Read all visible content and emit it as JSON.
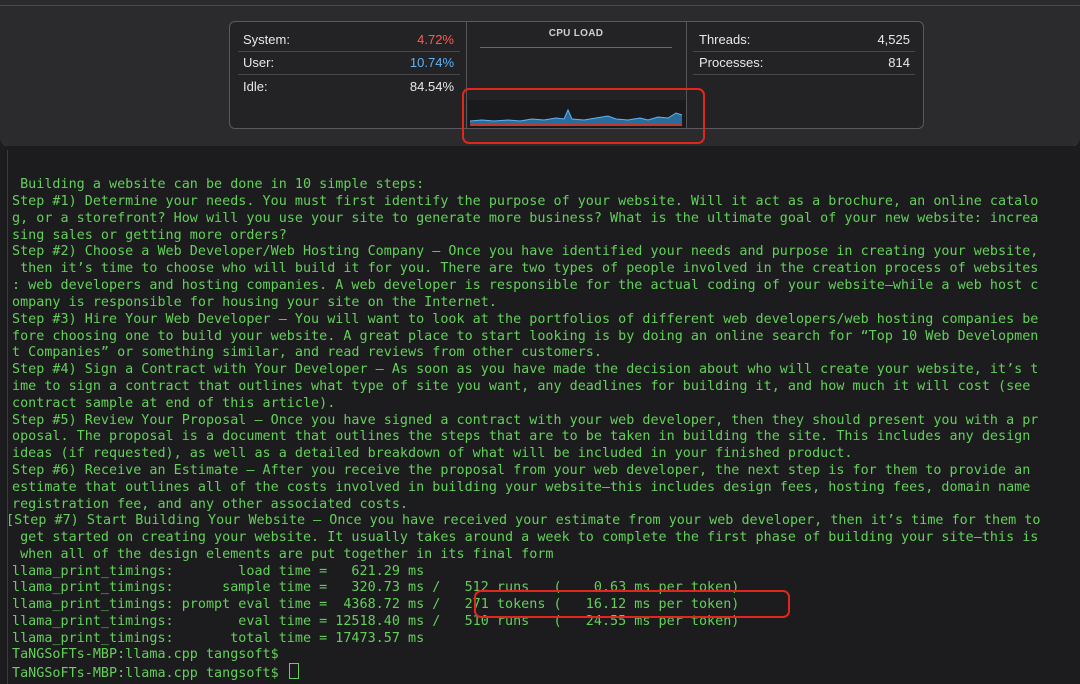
{
  "activity_monitor": {
    "system_label": "System:",
    "system_value": "4.72%",
    "user_label": "User:",
    "user_value": "10.74%",
    "idle_label": "Idle:",
    "idle_value": "84.54%",
    "cpu_title": "CPU LOAD",
    "threads_label": "Threads:",
    "threads_value": "4,525",
    "processes_label": "Processes:",
    "processes_value": "814",
    "colors": {
      "system": "#ff5b51",
      "user": "#5fb2f7",
      "highlight": "#e3261c"
    }
  },
  "terminal": {
    "lines": [
      " Building a website can be done in 10 simple steps:",
      "Step #1) Determine your needs. You must first identify the purpose of your website. Will it act as a brochure, an online catalo",
      "g, or a storefront? How will you use your site to generate more business? What is the ultimate goal of your new website: increa",
      "sing sales or getting more orders?",
      "Step #2) Choose a Web Developer/Web Hosting Company – Once you have identified your needs and purpose in creating your website,",
      " then it’s time to choose who will build it for you. There are two types of people involved in the creation process of websites",
      ": web developers and hosting companies. A web developer is responsible for the actual coding of your website—while a web host c",
      "ompany is responsible for housing your site on the Internet.",
      "Step #3) Hire Your Web Developer – You will want to look at the portfolios of different web developers/web hosting companies be",
      "fore choosing one to build your website. A great place to start looking is by doing an online search for “Top 10 Web Developmen",
      "t Companies” or something similar, and read reviews from other customers.",
      "Step #4) Sign a Contract with Your Developer – As soon as you have made the decision about who will create your website, it’s t",
      "ime to sign a contract that outlines what type of site you want, any deadlines for building it, and how much it will cost (see",
      "contract sample at end of this article).",
      "Step #5) Review Your Proposal – Once you have signed a contract with your web developer, then they should present you with a pr",
      "oposal. The proposal is a document that outlines the steps that are to be taken in building the site. This includes any design",
      "ideas (if requested), as well as a detailed breakdown of what will be included in your finished product.",
      "Step #6) Receive an Estimate – After you receive the proposal from your web developer, the next step is for them to provide an",
      "estimate that outlines all of the costs involved in building your website—this includes design fees, hosting fees, domain name",
      "registration fee, and any other associated costs.",
      "[Step #7) Start Building Your Website – Once you have received your estimate from your web developer, then it’s time for them to",
      " get started on creating your website. It usually takes around a week to complete the first phase of building your site—this is",
      " when all of the design elements are put together in its final form",
      "llama_print_timings:        load time =   621.29 ms",
      "llama_print_timings:      sample time =   320.73 ms /   512 runs   (    0.63 ms per token)",
      "llama_print_timings: prompt eval time =  4368.72 ms /   271 tokens (   16.12 ms per token)",
      "llama_print_timings:        eval time = 12518.40 ms /   510 runs   (   24.55 ms per token)",
      "llama_print_timings:       total time = 17473.57 ms",
      "TaNGSoFTs-MBP:llama.cpp tangsoft$",
      "TaNGSoFTs-MBP:llama.cpp tangsoft$"
    ]
  }
}
